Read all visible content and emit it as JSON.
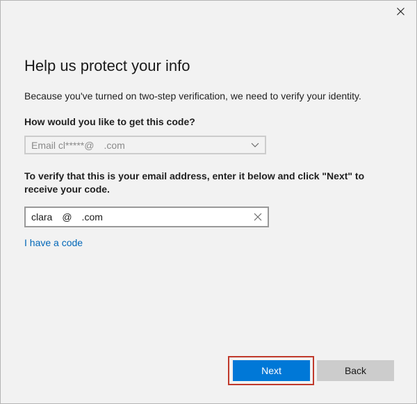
{
  "window": {
    "close_icon": "close-icon"
  },
  "page": {
    "title": "Help us protect your info",
    "description": "Because you've turned on two-step verification, we need to verify your identity.",
    "question": "How would you like to get this code?",
    "method_select": {
      "value": "Email cl*****@ .com",
      "icon": "chevron-down-icon"
    },
    "verify_instructions": "To verify that this is your email address, enter it below and click \"Next\" to receive your code.",
    "email_input": {
      "value": "clara @ .com",
      "clear_icon": "clear-x-icon"
    },
    "have_code_link": "I have a code"
  },
  "actions": {
    "next_label": "Next",
    "back_label": "Back"
  },
  "colors": {
    "accent": "#0078d7",
    "link": "#0067b8",
    "focus_highlight": "#c0392b",
    "background": "#f2f2f2"
  }
}
